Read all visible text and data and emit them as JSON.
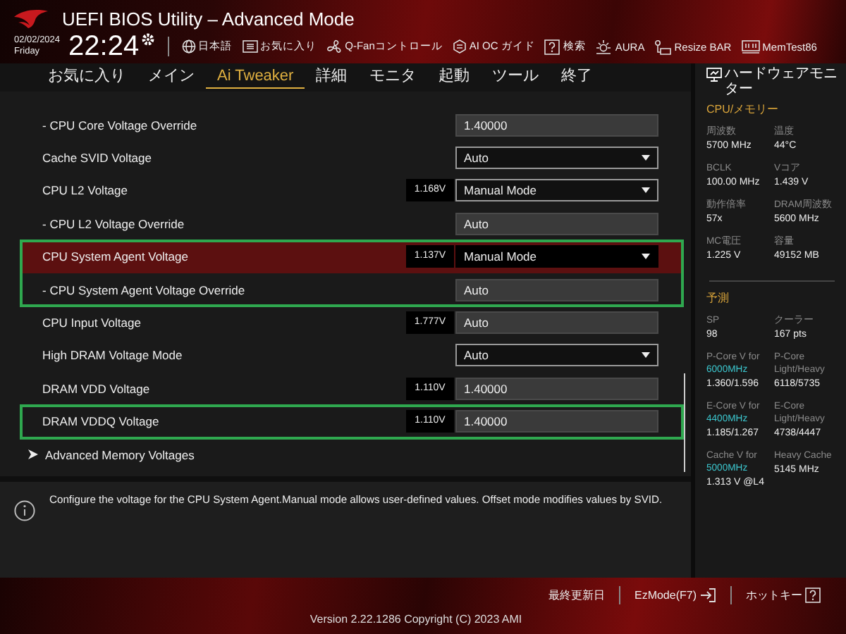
{
  "window": {
    "title": "UEFI BIOS Utility – Advanced Mode"
  },
  "clock": {
    "date": "02/02/2024",
    "day": "Friday",
    "time": "22:24"
  },
  "toolbar": [
    {
      "kind": "globe",
      "label": "日本語"
    },
    {
      "kind": "list",
      "label": "お気に入り"
    },
    {
      "kind": "fan",
      "label": "Q-Fanコントロール"
    },
    {
      "kind": "chip",
      "label": "AI OC ガイド"
    },
    {
      "kind": "help",
      "label": "検索"
    },
    {
      "kind": "light",
      "label": "AURA"
    },
    {
      "kind": "key",
      "label": "Resize BAR"
    },
    {
      "kind": "memory",
      "label": "MemTest86"
    }
  ],
  "tabs": [
    {
      "label": "お気に入り",
      "selected": false
    },
    {
      "label": "メイン",
      "selected": false
    },
    {
      "label": "Ai Tweaker",
      "selected": true
    },
    {
      "label": "詳細",
      "selected": false
    },
    {
      "label": "モニタ",
      "selected": false
    },
    {
      "label": "起動",
      "selected": false
    },
    {
      "label": "ツール",
      "selected": false
    },
    {
      "label": "終了",
      "selected": false
    }
  ],
  "settings": [
    {
      "outlined": false,
      "rows": [
        {
          "kind": "setting",
          "label": "- CPU Core Voltage Override",
          "selected": false,
          "control": {
            "kind": "field",
            "value": "1.40000"
          }
        },
        {
          "kind": "setting",
          "label": "Cache SVID Voltage",
          "selected": false,
          "control": {
            "kind": "dropdown",
            "value": "Auto"
          }
        },
        {
          "kind": "setting",
          "label": "CPU L2 Voltage",
          "selected": false,
          "reading": "1.168V",
          "control": {
            "kind": "dropdown",
            "value": "Manual Mode"
          }
        },
        {
          "kind": "setting",
          "label": "- CPU L2 Voltage Override",
          "selected": false,
          "control": {
            "kind": "field",
            "value": "Auto"
          }
        }
      ]
    },
    {
      "outlined": true,
      "rows": [
        {
          "kind": "setting",
          "label": "CPU System Agent Voltage",
          "selected": true,
          "reading": "1.137V",
          "control": {
            "kind": "dropdown",
            "value": "Manual Mode"
          }
        },
        {
          "kind": "setting",
          "label": "- CPU System Agent Voltage Override",
          "selected": false,
          "control": {
            "kind": "field",
            "value": "Auto"
          }
        }
      ]
    },
    {
      "outlined": false,
      "rows": [
        {
          "kind": "setting",
          "label": "CPU Input Voltage",
          "selected": false,
          "reading": "1.777V",
          "control": {
            "kind": "field",
            "value": "Auto"
          }
        },
        {
          "kind": "setting",
          "label": "High DRAM Voltage Mode",
          "selected": false,
          "control": {
            "kind": "dropdown",
            "value": "Auto"
          }
        },
        {
          "kind": "setting",
          "label": "DRAM VDD Voltage",
          "selected": false,
          "reading": "1.110V",
          "control": {
            "kind": "field",
            "value": "1.40000"
          }
        }
      ]
    },
    {
      "outlined": true,
      "rows": [
        {
          "kind": "setting",
          "label": "DRAM VDDQ Voltage",
          "selected": false,
          "reading": "1.110V",
          "control": {
            "kind": "field",
            "value": "1.40000"
          }
        }
      ]
    },
    {
      "outlined": false,
      "rows": [
        {
          "kind": "submenu",
          "label": "Advanced Memory Voltages",
          "selected": false
        }
      ]
    }
  ],
  "help": {
    "text": "Configure the voltage for the CPU System Agent.Manual mode allows user-defined values. Offset mode modifies values by SVID."
  },
  "monitor": {
    "title": "ハードウェアモニター",
    "sections": [
      {
        "title": "CPU/メモリー",
        "items": [
          {
            "label": "周波数",
            "value": "5700 MHz"
          },
          {
            "label": "温度",
            "value": "44°C"
          },
          {
            "label": "BCLK",
            "value": "100.00 MHz"
          },
          {
            "label": "Vコア",
            "value": "1.439 V"
          },
          {
            "label": "動作倍率",
            "value": "57x"
          },
          {
            "label": "DRAM周波数",
            "value": "5600 MHz"
          },
          {
            "label": "MC電圧",
            "value": "1.225 V"
          },
          {
            "label": "容量",
            "value": "49152 MB"
          }
        ]
      },
      {
        "title": "予測",
        "items": [
          {
            "label": "SP",
            "value": "98"
          },
          {
            "label": "クーラー",
            "value": "167 pts"
          },
          {
            "label": "P-Core V for",
            "freq": "6000MHz",
            "value": "1.360/1.596"
          },
          {
            "label": "P-Core Light/Heavy",
            "value": "6118/5735"
          },
          {
            "label": "E-Core V for",
            "freq": "4400MHz",
            "value": "1.185/1.267"
          },
          {
            "label": "E-Core Light/Heavy",
            "value": "4738/4447"
          },
          {
            "label": "Cache V for",
            "freq": "5000MHz",
            "value": "1.313 V @L4"
          },
          {
            "label": "Heavy Cache",
            "value": "5145 MHz"
          }
        ]
      }
    ]
  },
  "footer": {
    "buttons": [
      {
        "kind": "plain",
        "label": "最終更新日"
      },
      {
        "kind": "exit",
        "label": "EzMode(F7)"
      },
      {
        "kind": "help",
        "label": "ホットキー"
      }
    ],
    "version": "Version 2.22.1286 Copyright (C) 2023 AMI"
  }
}
